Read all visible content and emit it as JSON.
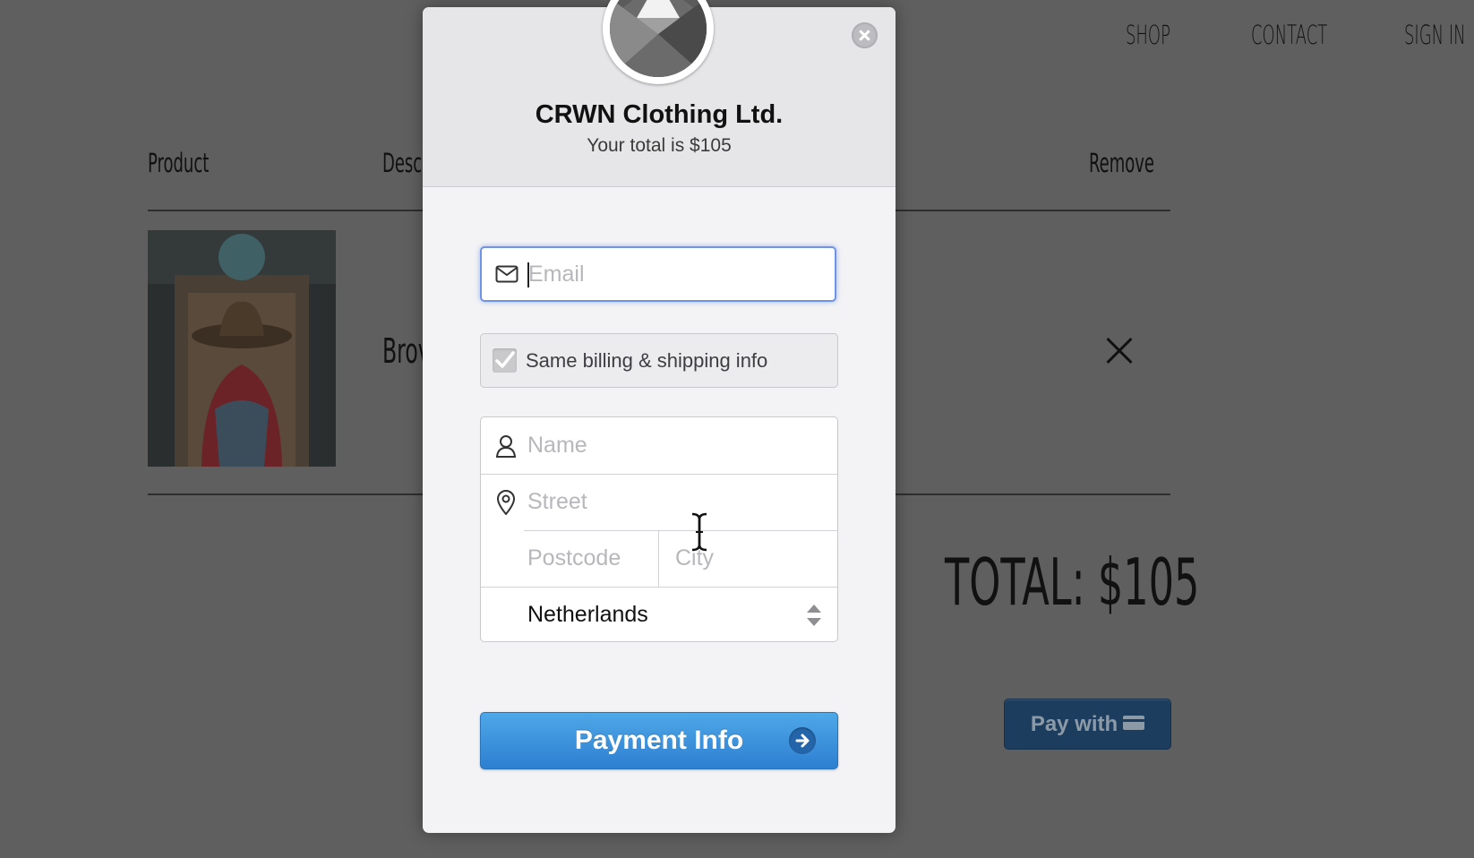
{
  "nav": {
    "shop": "SHOP",
    "contact": "CONTACT",
    "sign_in": "SIGN IN"
  },
  "table": {
    "headers": {
      "product": "Product",
      "description": "Desc",
      "remove": "Remove"
    },
    "row": {
      "description": "Brov"
    }
  },
  "total": "TOTAL: $105",
  "pay_with": "Pay with",
  "modal": {
    "store_name": "CRWN Clothing Ltd.",
    "total_text": "Your total is $105",
    "email_placeholder": "Email",
    "same_info_label": "Same billing & shipping info",
    "same_info_checked": true,
    "name_placeholder": "Name",
    "street_placeholder": "Street",
    "postcode_placeholder": "Postcode",
    "city_placeholder": "City",
    "country": "Netherlands",
    "submit_label": "Payment Info"
  },
  "icons": {
    "email": "envelope-icon",
    "name": "person-icon",
    "street": "location-pin-icon",
    "close": "close-icon",
    "submit": "arrow-right-icon",
    "card": "credit-card-icon"
  },
  "colors": {
    "overlay": "#5f5f5f",
    "primary_button": "#3a93dc",
    "focus_ring": "#6f93e6"
  }
}
